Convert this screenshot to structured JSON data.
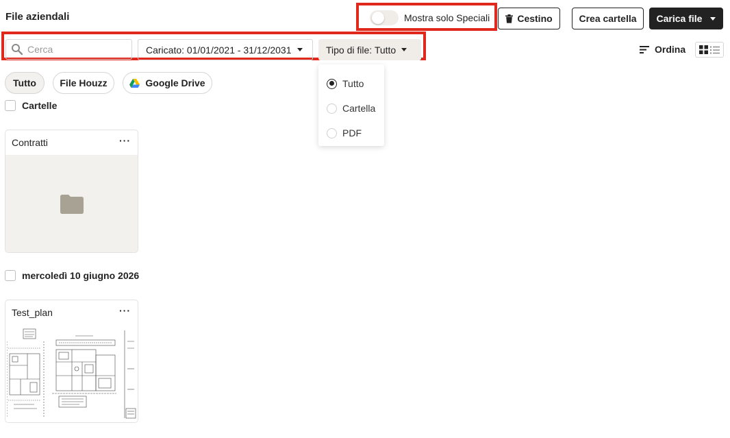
{
  "header": {
    "title": "File aziendali",
    "toggle_label": "Mostra solo Speciali",
    "toggle_on": false,
    "trash_label": "Cestino",
    "new_folder_label": "Crea cartella",
    "upload_label": "Carica file"
  },
  "filters": {
    "search_placeholder": "Cerca",
    "search_value": "",
    "date_label": "Caricato: 01/01/2021 - 31/12/2031",
    "type_label": "Tipo di file: Tutto",
    "sort_label": "Ordina",
    "type_options": [
      {
        "label": "Tutto",
        "selected": true
      },
      {
        "label": "Cartella",
        "selected": false
      },
      {
        "label": "PDF",
        "selected": false
      }
    ]
  },
  "sources": [
    {
      "label": "Tutto",
      "active": true
    },
    {
      "label": "File Houzz",
      "active": false
    },
    {
      "label": "Google Drive",
      "active": false
    }
  ],
  "sections": {
    "folders": {
      "label": "Cartelle",
      "items": [
        {
          "name": "Contratti",
          "more": "···"
        }
      ]
    },
    "dated": {
      "label": "mercoledì 10 giugno 2026",
      "items": [
        {
          "name": "Test_plan",
          "more": "···"
        }
      ]
    }
  },
  "colors": {
    "highlight": "#e0291c",
    "primary": "#222222",
    "chip_active_bg": "#f3f1ed",
    "folder_icon": "#a8a294"
  }
}
